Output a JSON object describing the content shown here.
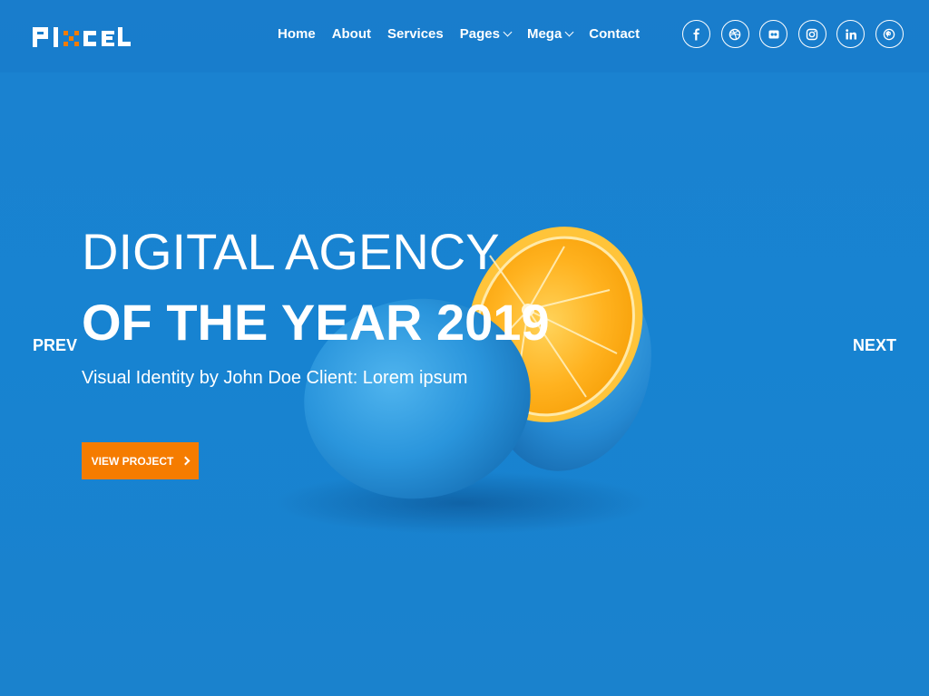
{
  "brand": {
    "logo_text": "PIXCL",
    "colors": {
      "primary_blue": "#1783d1",
      "accent_orange": "#f57c00",
      "white": "#ffffff"
    }
  },
  "nav": {
    "items": [
      {
        "label": "Home",
        "has_dropdown": false
      },
      {
        "label": "About",
        "has_dropdown": false
      },
      {
        "label": "Services",
        "has_dropdown": false
      },
      {
        "label": "Pages",
        "has_dropdown": true
      },
      {
        "label": "Mega",
        "has_dropdown": true
      },
      {
        "label": "Contact",
        "has_dropdown": false
      }
    ]
  },
  "social": {
    "icons": [
      "facebook-icon",
      "dribbble-icon",
      "flickr-icon",
      "instagram-icon",
      "linkedin-icon",
      "pinterest-icon"
    ]
  },
  "hero": {
    "title_line1": "DIGITAL AGENCY",
    "title_line2": "OF THE YEAR 2019",
    "subtitle": "Visual Identity by John Doe Client: Lorem ipsum",
    "cta_label": "VIEW PROJECT",
    "prev_label": "PREV",
    "next_label": "NEXT"
  }
}
